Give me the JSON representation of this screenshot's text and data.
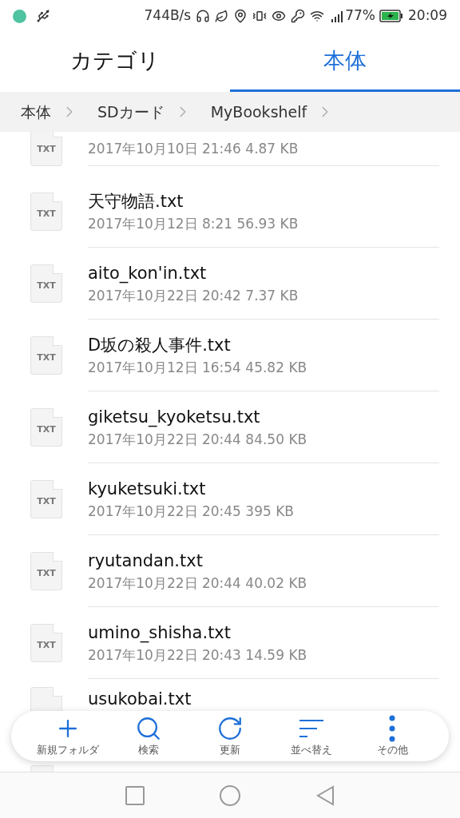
{
  "status_bar": {
    "speed": "744B/s",
    "battery": "77%",
    "time": "20:09"
  },
  "tabs": [
    {
      "label": "カテゴリ",
      "selected": false
    },
    {
      "label": "本体",
      "selected": true
    }
  ],
  "breadcrumb": [
    "本体",
    "SDカード",
    "MyBookshelf"
  ],
  "files": [
    {
      "type": "TXT",
      "meta": "2017年10月10日 21:46 4.87 KB"
    },
    {
      "type": "TXT",
      "name": "天守物語.txt",
      "meta": "2017年10月12日 8:21 56.93 KB"
    },
    {
      "type": "TXT",
      "name": "aito_kon'in.txt",
      "meta": "2017年10月22日 20:42 7.37 KB"
    },
    {
      "type": "TXT",
      "name": "D坂の殺人事件.txt",
      "meta": "2017年10月12日 16:54 45.82 KB"
    },
    {
      "type": "TXT",
      "name": "giketsu_kyoketsu.txt",
      "meta": "2017年10月22日 20:44 84.50 KB"
    },
    {
      "type": "TXT",
      "name": "kyuketsuki.txt",
      "meta": "2017年10月22日 20:45 395 KB"
    },
    {
      "type": "TXT",
      "name": "ryutandan.txt",
      "meta": "2017年10月22日 20:44 40.02 KB"
    },
    {
      "type": "TXT",
      "name": "umino_shisha.txt",
      "meta": "2017年10月22日 20:43 14.59 KB"
    },
    {
      "name": "usukobai.txt"
    }
  ],
  "toolbar": [
    {
      "kind": "add",
      "label": "新規フォルダ"
    },
    {
      "kind": "search",
      "label": "検索"
    },
    {
      "kind": "refresh",
      "label": "更新"
    },
    {
      "kind": "sort",
      "label": "並べ替え"
    },
    {
      "kind": "more",
      "label": "その他"
    }
  ]
}
